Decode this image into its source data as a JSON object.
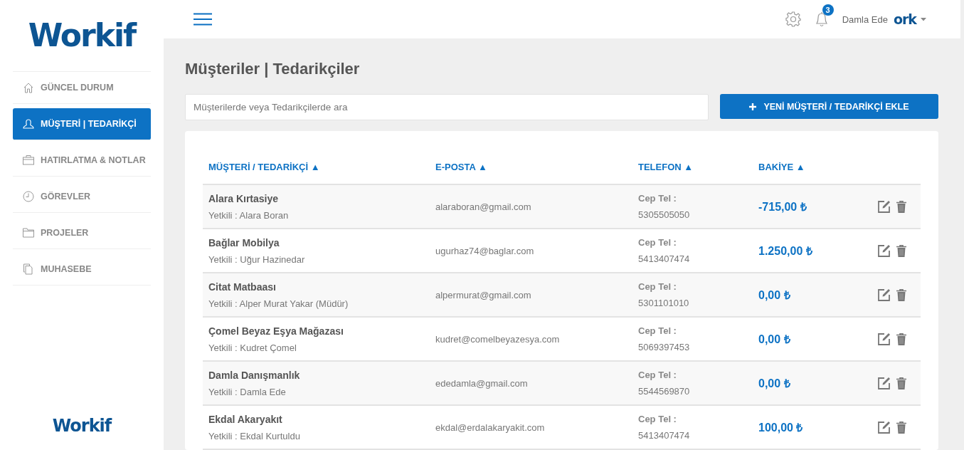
{
  "sidebar": {
    "logo": "Workif",
    "items": [
      {
        "label": "GÜNCEL DURUM",
        "selected": false
      },
      {
        "label": "MÜŞTERİ | TEDARİKÇİ",
        "selected": true
      },
      {
        "label": "HATIRLATMA & NOTLAR",
        "selected": false
      },
      {
        "label": "GÖREVLER",
        "selected": false
      },
      {
        "label": "PROJELER",
        "selected": false
      },
      {
        "label": "MUHASEBE",
        "selected": false
      }
    ],
    "footer_logo": "Workif"
  },
  "header": {
    "notification_count": "3",
    "user_name": "Damla Ede",
    "user_logo": "ork"
  },
  "page": {
    "title": "Müşteriler | Tedarikçiler",
    "search": {
      "placeholder": "Müşterilerde veya Tedarikçilerde ara"
    },
    "add_button": "YENİ MÜŞTERİ / TEDARİKÇİ EKLE"
  },
  "table": {
    "columns": [
      "MÜŞTERİ / TEDARİKÇİ ▲",
      "E-POSTA ▲",
      "TELEFON ▲",
      "BAKİYE ▲"
    ],
    "rows": [
      {
        "name": "Alara Kırtasiye",
        "contact": "Yetkili : Alara Boran",
        "email": "alaraboran@gmail.com",
        "phone_label": "Cep Tel :",
        "phone": "5305505050",
        "balance": "-715,00 ₺"
      },
      {
        "name": "Bağlar Mobilya",
        "contact": "Yetkili : Uğur Hazinedar",
        "email": "ugurhaz74@baglar.com",
        "phone_label": "Cep Tel :",
        "phone": "5413407474",
        "balance": "1.250,00 ₺"
      },
      {
        "name": "Citat Matbaası",
        "contact": "Yetkili : Alper Murat Yakar (Müdür)",
        "email": "alpermurat@gmail.com",
        "phone_label": "Cep Tel :",
        "phone": "5301101010",
        "balance": "0,00 ₺"
      },
      {
        "name": "Çomel Beyaz Eşya Mağazası",
        "contact": "Yetkili : Kudret Çomel",
        "email": "kudret@comelbeyazesya.com",
        "phone_label": "Cep Tel :",
        "phone": "5069397453",
        "balance": "0,00 ₺"
      },
      {
        "name": "Damla Danışmanlık",
        "contact": "Yetkili : Damla Ede",
        "email": "ededamla@gmail.com",
        "phone_label": "Cep Tel :",
        "phone": "5544569870",
        "balance": "0,00 ₺"
      },
      {
        "name": "Ekdal Akaryakıt",
        "contact": "Yetkili : Ekdal Kurtuldu",
        "email": "ekdal@erdalakaryakit.com",
        "phone_label": "Cep Tel :",
        "phone": "5413407474",
        "balance": "100,00 ₺"
      }
    ]
  }
}
